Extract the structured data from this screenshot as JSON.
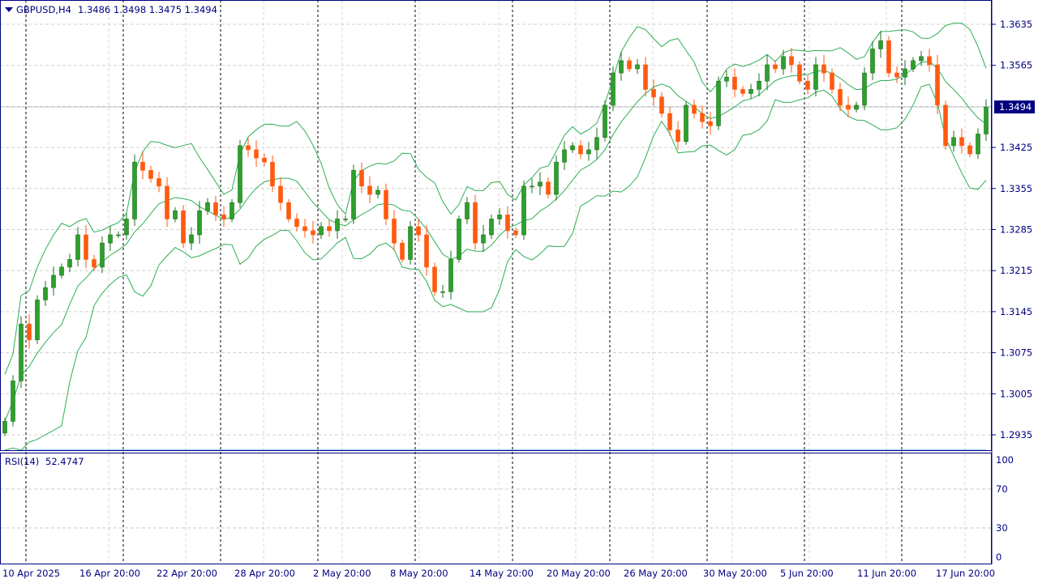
{
  "header": {
    "symbol": "GBPUSD,H4",
    "ohlc": "1.3486 1.3498 1.3475 1.3494"
  },
  "rsi_label": {
    "name": "RSI(14)",
    "value": "52.4747"
  },
  "colors": {
    "up": "#2ca02c",
    "down": "#ff5a10",
    "bands": "#2eae55",
    "rsi": "#1e90ff",
    "axis": "#000080",
    "current_price_bg": "#000080"
  },
  "chart_data": {
    "type": "candlestick",
    "symbol": "GBPUSD",
    "timeframe": "H4",
    "current_price": "1.3494",
    "price_ticks": [
      "1.3635",
      "1.3565",
      "1.3425",
      "1.3355",
      "1.3285",
      "1.3215",
      "1.3145",
      "1.3075",
      "1.3005",
      "1.2935"
    ],
    "ylim": [
      1.2935,
      1.3635
    ],
    "time_ticks": [
      "10 Apr 2025",
      "16 Apr 20:00",
      "22 Apr 20:00",
      "28 Apr 20:00",
      "2 May 20:00",
      "8 May 20:00",
      "14 May 20:00",
      "20 May 20:00",
      "26 May 20:00",
      "30 May 20:00",
      "5 Jun 20:00",
      "11 Jun 20:00",
      "17 Jun 20:00"
    ],
    "closes": [
      1.2958,
      1.3027,
      1.3124,
      1.3097,
      1.3165,
      1.3186,
      1.3207,
      1.3221,
      1.3234,
      1.3276,
      1.3234,
      1.3221,
      1.3262,
      1.3276,
      1.3276,
      1.3303,
      1.34,
      1.3386,
      1.3372,
      1.3359,
      1.3303,
      1.3317,
      1.3262,
      1.3276,
      1.3317,
      1.3331,
      1.331,
      1.3303,
      1.3331,
      1.3428,
      1.3421,
      1.3407,
      1.34,
      1.3359,
      1.3331,
      1.3303,
      1.329,
      1.3283,
      1.3276,
      1.329,
      1.3283,
      1.3303,
      1.3303,
      1.3386,
      1.3359,
      1.3345,
      1.3352,
      1.3303,
      1.3262,
      1.3234,
      1.329,
      1.3276,
      1.3221,
      1.3179,
      1.3179,
      1.3234,
      1.3303,
      1.3331,
      1.3262,
      1.3276,
      1.3303,
      1.331,
      1.3283,
      1.3276,
      1.3359,
      1.3359,
      1.3366,
      1.3345,
      1.34,
      1.3421,
      1.3428,
      1.3414,
      1.3421,
      1.3442,
      1.3497,
      1.3552,
      1.3573,
      1.3559,
      1.3566,
      1.3524,
      1.3511,
      1.3483,
      1.3455,
      1.3435,
      1.3497,
      1.3483,
      1.3469,
      1.3462,
      1.3538,
      1.3545,
      1.3524,
      1.3517,
      1.3524,
      1.3538,
      1.3566,
      1.3559,
      1.358,
      1.3566,
      1.3538,
      1.3524,
      1.3566,
      1.3552,
      1.3524,
      1.3497,
      1.349,
      1.3497,
      1.3552,
      1.3593,
      1.3607,
      1.3552,
      1.3545,
      1.3559,
      1.3573,
      1.358,
      1.3566,
      1.3497,
      1.3428,
      1.3442,
      1.3428,
      1.3414,
      1.3448,
      1.3494
    ],
    "indicators": [
      {
        "name": "Bollinger Bands",
        "color": "#2eae55"
      },
      {
        "name": "RSI(14)",
        "levels": [
          30,
          70
        ],
        "ylim": [
          0,
          100
        ],
        "ticks": [
          "100",
          "70",
          "30",
          "0"
        ]
      }
    ],
    "grid": true
  }
}
